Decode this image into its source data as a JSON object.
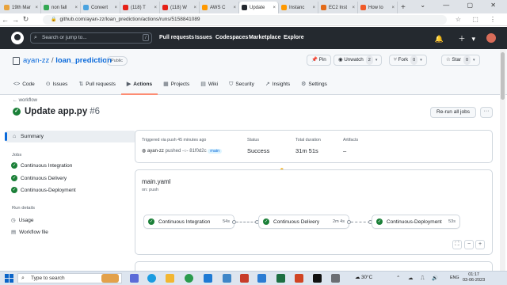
{
  "browser": {
    "tabs": [
      {
        "label": "19th Mar",
        "color": "#e8a33d"
      },
      {
        "label": "non fall",
        "color": "#34a853"
      },
      {
        "label": "Convert",
        "color": "#4aa3df"
      },
      {
        "label": "(118) T",
        "color": "#e62117"
      },
      {
        "label": "(118) W",
        "color": "#e62117"
      },
      {
        "label": "AWS C",
        "color": "#ff9900"
      },
      {
        "label": "Update",
        "color": "#24292f",
        "active": true
      },
      {
        "label": "Instanc",
        "color": "#ff9900"
      },
      {
        "label": "EC2 Inst",
        "color": "#e36b19"
      },
      {
        "label": "How to",
        "color": "#f05a28"
      }
    ],
    "new_tab": "+",
    "url": "github.com/ayan-zz/loan_prediction/actions/runs/5158841089",
    "nav": {
      "back": "←",
      "forward": "→",
      "reload": "↻"
    },
    "window_controls": "⌄ — ▢ ✕",
    "extensions": "☆ ⬚ ⋮"
  },
  "gh": {
    "search_placeholder": "Search or jump to...",
    "search_key": "/",
    "nav": [
      "Pull requests",
      "Issues",
      "Codespaces",
      "Marketplace",
      "Explore"
    ],
    "right_icons": "🔔 ＋▾"
  },
  "repo": {
    "owner": "ayan-zz",
    "separator": " / ",
    "name": "loan_prediction",
    "visibility": "Public",
    "pin": "Pin",
    "unwatch": "Unwatch",
    "unwatch_count": "2",
    "fork": "Fork",
    "fork_count": "0",
    "star": "Star",
    "star_count": "0",
    "tabs": [
      {
        "icon": "<>",
        "label": "Code"
      },
      {
        "icon": "⊙",
        "label": "Issues"
      },
      {
        "icon": "⇅",
        "label": "Pull requests"
      },
      {
        "icon": "▶",
        "label": "Actions",
        "active": true
      },
      {
        "icon": "▦",
        "label": "Projects"
      },
      {
        "icon": "▤",
        "label": "Wiki"
      },
      {
        "icon": "⛉",
        "label": "Security"
      },
      {
        "icon": "↗",
        "label": "Insights"
      },
      {
        "icon": "⚙",
        "label": "Settings"
      }
    ]
  },
  "run": {
    "back_label": "← workflow",
    "title": "Update app.py",
    "number": "#6",
    "rerun_label": "Re-run all jobs",
    "more": "···",
    "status_icon": "✓"
  },
  "sidebar": {
    "summary": "Summary",
    "summary_icon": "⌂",
    "jobs_heading": "Jobs",
    "jobs": [
      "Continuous Integration",
      "Continuous Delivery",
      "Continuous-Deployment"
    ],
    "details_heading": "Run details",
    "usage": "Usage",
    "usage_icon": "◷",
    "workflow_file": "Workflow file",
    "workflow_file_icon": "▤"
  },
  "info": {
    "trigger_label": "Triggered via push 45 minutes ago",
    "actor": "ayan-zz",
    "pushed": "pushed",
    "sha": "-○- 81f0d2c",
    "branch": "main",
    "status_label": "Status",
    "status_value": "Success",
    "duration_label": "Total duration",
    "duration_value": "31m 51s",
    "artifacts_label": "Artifacts",
    "artifacts_value": "–"
  },
  "workflow": {
    "file": "main.yaml",
    "trigger": "on: push",
    "jobs": [
      {
        "name": "Continuous Integration",
        "duration": "54s"
      },
      {
        "name": "Continuous Delivery",
        "duration": "2m 4s"
      },
      {
        "name": "Continuous-Deployment",
        "duration": "53s"
      }
    ],
    "zoom_fit": "⛶",
    "zoom_out": "−",
    "zoom_in": "+"
  },
  "taskbar": {
    "search_placeholder": "Type to search",
    "search_icon": "⌕",
    "weather": "30°C",
    "tray": "⌃ ☁ ⎍ 🔊",
    "lang": "ENG",
    "time": "01:17",
    "date": "03-06-2023"
  },
  "colors": {
    "accent": "#0969da",
    "success": "#1a7f37",
    "header_bg": "#24292f",
    "tab_underline": "#fd8c73"
  }
}
